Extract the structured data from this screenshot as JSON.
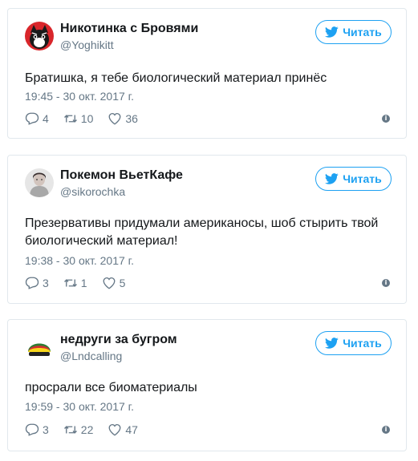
{
  "tweets": [
    {
      "name": "Никотинка с Бровями",
      "handle": "@Yoghikitt",
      "follow_label": "Читать",
      "text": "Братишка, я тебе биологический материал принёс",
      "date": "19:45 - 30 окт. 2017 г.",
      "replies": "4",
      "retweets": "10",
      "likes": "36",
      "avatar_icon": "cat-face-avatar"
    },
    {
      "name": "Покемон ВьетКафе",
      "handle": "@sikorochka",
      "follow_label": "Читать",
      "text": "Презервативы придумали американосы, шоб стырить твой биологический материал!",
      "date": "19:38 - 30 окт. 2017 г.",
      "replies": "3",
      "retweets": "1",
      "likes": "5",
      "avatar_icon": "portrait-avatar"
    },
    {
      "name": "недруги за бугром",
      "handle": "@Lndcalling",
      "follow_label": "Читать",
      "text": "просрали все биоматериалы",
      "date": "19:59 - 30 окт. 2017 г.",
      "replies": "3",
      "retweets": "22",
      "likes": "47",
      "avatar_icon": "rasta-hat-avatar"
    }
  ],
  "colors": {
    "accent": "#1da1f2",
    "muted": "#657786",
    "border": "#e1e8ed",
    "text": "#14171a"
  }
}
